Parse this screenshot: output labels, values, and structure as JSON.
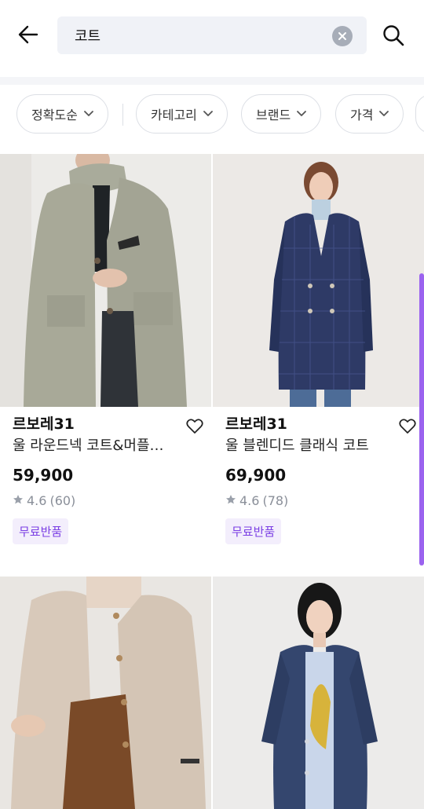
{
  "search": {
    "query": "코트"
  },
  "filters": [
    {
      "label": "정확도순"
    },
    {
      "label": "카테고리"
    },
    {
      "label": "브랜드"
    },
    {
      "label": "가격"
    }
  ],
  "products": [
    {
      "brand": "르보레31",
      "name": "울 라운드넥 코트&머플…",
      "price": "59,900",
      "rating": "4.6",
      "reviews": "(60)",
      "badge": "무료반품"
    },
    {
      "brand": "르보레31",
      "name": "울 블렌디드 클래식 코트",
      "price": "69,900",
      "rating": "4.6",
      "reviews": "(78)",
      "badge": "무료반품"
    },
    {
      "brand": "",
      "name": "",
      "price": "",
      "rating": "",
      "reviews": "",
      "badge": ""
    },
    {
      "brand": "",
      "name": "",
      "price": "",
      "rating": "",
      "reviews": "",
      "badge": ""
    }
  ],
  "colors": {
    "accent": "#7b3fe4",
    "badge_bg": "#f3eefc",
    "search_bg": "#f0f2f7"
  }
}
